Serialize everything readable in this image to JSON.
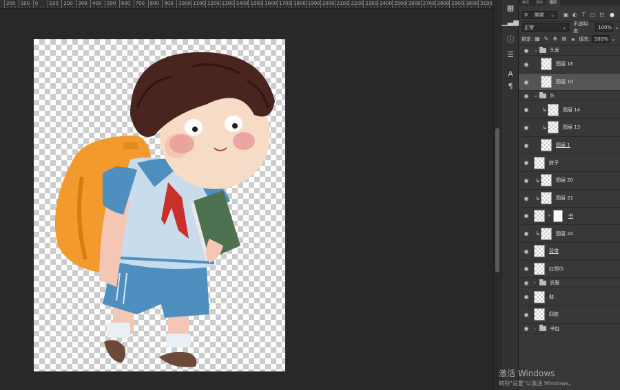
{
  "ruler": {
    "labels": [
      "200",
      "100",
      "0",
      "100",
      "200",
      "300",
      "400",
      "500",
      "600",
      "700",
      "800",
      "900",
      "1000",
      "1100",
      "1200",
      "1300",
      "1400",
      "1500",
      "1600",
      "1700",
      "1800",
      "1900",
      "2000",
      "2100",
      "2200",
      "2300",
      "2400",
      "2500",
      "2600",
      "2700",
      "2800",
      "2900",
      "3000",
      "3100"
    ]
  },
  "panel": {
    "tabs": [
      "路径",
      "通道",
      "图层"
    ],
    "filter_kind": "类型",
    "blend_mode": "正常",
    "opacity_label": "不透明度:",
    "opacity_value": "100%",
    "lock_label": "锁定:",
    "fill_label": "填充:",
    "fill_value": "100%",
    "layers": [
      {
        "name": "头发",
        "type": "group",
        "indent": 0,
        "expanded": true
      },
      {
        "name": "图层 16",
        "type": "layer",
        "indent": 1
      },
      {
        "name": "图层 10",
        "type": "layer",
        "indent": 1,
        "selected": true
      },
      {
        "name": "头",
        "type": "group",
        "indent": 0,
        "expanded": true
      },
      {
        "name": "图层 14",
        "type": "layer",
        "indent": 1,
        "clip": true
      },
      {
        "name": "图层 13",
        "type": "layer",
        "indent": 1,
        "clip": true
      },
      {
        "name": "图层 1",
        "type": "layer",
        "indent": 1,
        "underline": true
      },
      {
        "name": "脖子",
        "type": "layer",
        "indent": 0
      },
      {
        "name": "图层 20",
        "type": "layer",
        "indent": 0,
        "clip": true
      },
      {
        "name": "图层 21",
        "type": "layer",
        "indent": 0,
        "clip": true
      },
      {
        "name": "书",
        "type": "layer",
        "indent": 0,
        "mask": true,
        "underline": true
      },
      {
        "name": "图层 24",
        "type": "layer",
        "indent": 0,
        "clip": true
      },
      {
        "name": "背带",
        "type": "layer",
        "indent": 0,
        "underline": true
      },
      {
        "name": "红领巾",
        "type": "layer",
        "indent": 0
      },
      {
        "name": "衣服",
        "type": "group",
        "indent": 0,
        "expanded": false
      },
      {
        "name": "鞋",
        "type": "layer",
        "indent": 0
      },
      {
        "name": "四肢",
        "type": "layer",
        "indent": 0
      },
      {
        "name": "书包",
        "type": "group",
        "indent": 0,
        "expanded": false
      }
    ]
  },
  "watermark": {
    "title": "激活 Windows",
    "subtitle": "转到\"设置\"以激活 Windows。"
  }
}
